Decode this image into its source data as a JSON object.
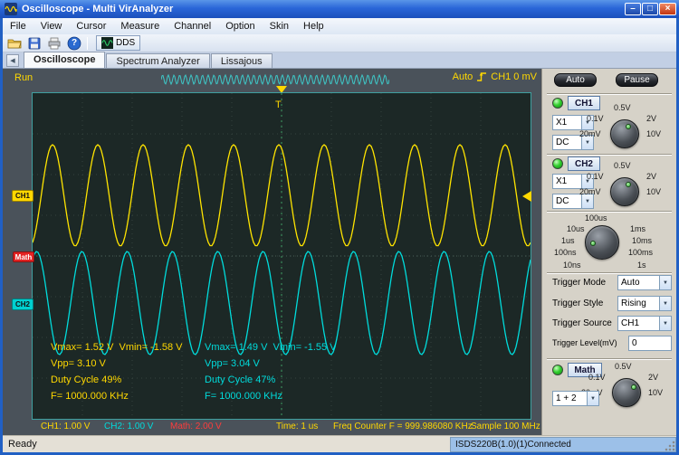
{
  "window": {
    "title": "Oscilloscope - Multi VirAnalyzer"
  },
  "icons": {
    "chevron_down": "▼",
    "tab_scroll_left": "◀",
    "minimize": "–",
    "maximize": "□",
    "close": "×",
    "help": "?"
  },
  "menu": {
    "items": [
      "File",
      "View",
      "Cursor",
      "Measure",
      "Channel",
      "Option",
      "Skin",
      "Help"
    ]
  },
  "toolbar": {
    "dds": "DDS"
  },
  "tabs": {
    "items": [
      "Oscilloscope",
      "Spectrum Analyzer",
      "Lissajous"
    ]
  },
  "scope": {
    "run": "Run",
    "trigger_mode": "Auto",
    "trigger_info": "CH1 0 mV",
    "t_marker": "T",
    "markers": {
      "ch1": "CH1",
      "math": "Math",
      "ch2": "CH2"
    },
    "measure_ch1": {
      "line1": "Vmax= 1.52 V  Vmin= -1.58 V",
      "line2": "Vpp= 3.10 V",
      "line3": "Duty Cycle 49%",
      "line4": "F= 1000.000 KHz"
    },
    "measure_ch2": {
      "line1": "Vmax= 1.49 V  Vmin= -1.55 V",
      "line2": "Vpp= 3.04 V",
      "line3": "Duty Cycle 47%",
      "line4": "F= 1000.000 KHz"
    },
    "status": {
      "ch1": "CH1: 1.00 V",
      "ch2": "CH2: 1.00 V",
      "math": "Math: 2.00 V",
      "time": "Time: 1 us",
      "freq": "Freq Counter F = 999.986080 KHz",
      "sample": "Sample 100 MHz"
    }
  },
  "waveforms": {
    "ch1": {
      "color": "#ffe400",
      "cycles": 11,
      "amplitude": 56,
      "center": 113,
      "phase": -1.2
    },
    "ch2": {
      "color": "#00dcdc",
      "cycles": 11,
      "amplitude": 57,
      "center": 232,
      "phase": 1.0
    },
    "preview": {
      "color": "#3ec8c8",
      "cycles": 40,
      "amplitude": 5
    }
  },
  "panel": {
    "auto": "Auto",
    "pause": "Pause",
    "ch1": {
      "name": "CH1",
      "probe": "X1",
      "coupling": "DC"
    },
    "ch2": {
      "name": "CH2",
      "probe": "X1",
      "coupling": "DC"
    },
    "gain_labels": [
      "0.5V",
      "0.1V",
      "2V",
      "20mV",
      "10V"
    ],
    "timebase_labels": [
      "100us",
      "10us",
      "1ms",
      "1us",
      "10ms",
      "100ns",
      "100ms",
      "10ns",
      "1s"
    ],
    "trigger": {
      "mode_label": "Trigger Mode",
      "mode": "Auto",
      "style_label": "Trigger Style",
      "style": "Rising",
      "source_label": "Trigger Source",
      "source": "CH1",
      "level_label": "Trigger Level(mV)",
      "level": "0"
    },
    "math": {
      "name": "Math",
      "operation": "1 + 2"
    }
  },
  "statusbar": {
    "ready": "Ready",
    "device": "ISDS220B(1.0)(1)Connected"
  }
}
